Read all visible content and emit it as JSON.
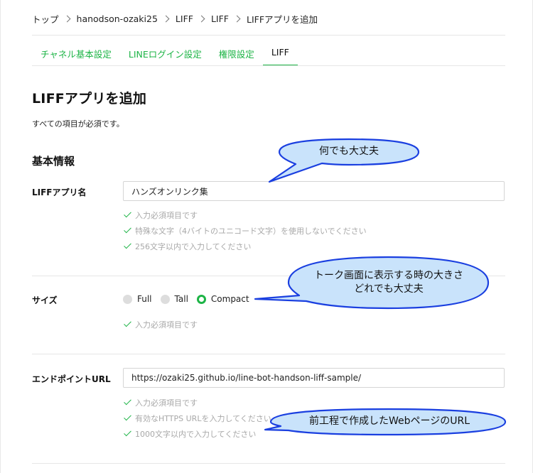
{
  "breadcrumb": [
    "トップ",
    "hanodson-ozaki25",
    "LIFF",
    "LIFF",
    "LIFFアプリを追加"
  ],
  "tabs": [
    {
      "label": "チャネル基本設定",
      "active": false
    },
    {
      "label": "LINEログイン設定",
      "active": false
    },
    {
      "label": "権限設定",
      "active": false
    },
    {
      "label": "LIFF",
      "active": true
    }
  ],
  "page_title": "LIFFアプリを追加",
  "required_note": "すべての項目が必須です。",
  "section_title": "基本情報",
  "app_name": {
    "label": "LIFFアプリ名",
    "value": "ハンズオンリンク集",
    "checks": [
      "入力必須項目です",
      "特殊な文字（4バイトのユニコード文字）を使用しないでください",
      "256文字以内で入力してください"
    ]
  },
  "size": {
    "label": "サイズ",
    "options": [
      "Full",
      "Tall",
      "Compact"
    ],
    "selected": "Compact",
    "checks": [
      "入力必須項目です"
    ]
  },
  "endpoint": {
    "label": "エンドポイントURL",
    "value": "https://ozaki25.github.io/line-bot-handson-liff-sample/",
    "checks": [
      "入力必須項目です",
      "有効なHTTPS URLを入力してください",
      "1000文字以内で入力してください"
    ]
  },
  "callouts": {
    "name": "何でも大丈夫",
    "size_line1": "トーク画面に表示する時の大きさ",
    "size_line2": "どれでも大丈夫",
    "endpoint": "前工程で作成したWebページのURL"
  },
  "colors": {
    "accent": "#1db446",
    "callout_border": "#1a3fe0"
  },
  "icons": [
    "chevron-right-icon",
    "check-icon",
    "radio-icon"
  ]
}
